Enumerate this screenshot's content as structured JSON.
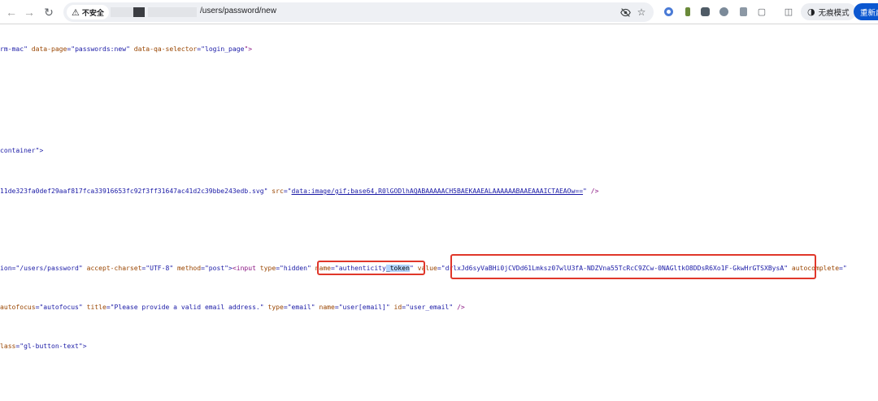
{
  "browser": {
    "security_label": "不安全",
    "url": "/users/password/new",
    "incognito_label": "无痕模式",
    "relaunch_label": "重新启"
  },
  "source": {
    "line1": [
      {
        "t": "rm-mac\" ",
        "c": "val"
      },
      {
        "t": "data-page",
        "c": "attr"
      },
      {
        "t": "=\"",
        "c": "val"
      },
      {
        "t": "passwords:new",
        "c": "val"
      },
      {
        "t": "\" ",
        "c": "val"
      },
      {
        "t": "data-qa-selector",
        "c": "attr"
      },
      {
        "t": "=\"",
        "c": "val"
      },
      {
        "t": "login_page",
        "c": "val"
      },
      {
        "t": "\">",
        "c": "tag"
      }
    ],
    "line2": [
      {
        "t": "container\">",
        "c": "val"
      }
    ],
    "line3": [
      {
        "t": "11de323fa0def29aaf817fca33916653fc92f3ff31647ac41d2c39bbe243edb.svg\" ",
        "c": "val"
      },
      {
        "t": "src",
        "c": "attr"
      },
      {
        "t": "=\"",
        "c": "val"
      },
      {
        "t": "data:image/gif;base64,R0lGODlhAQABAAAAACH5BAEKAAEALAAAAAABAAEAAAICTAEAOw==",
        "c": "link"
      },
      {
        "t": "\" ",
        "c": "val"
      },
      {
        "t": "/>",
        "c": "tag"
      }
    ],
    "line4": [
      {
        "t": "ion=\"/users/password\" ",
        "c": "val"
      },
      {
        "t": "accept-charset",
        "c": "attr"
      },
      {
        "t": "=\"UTF-8\" ",
        "c": "val"
      },
      {
        "t": "method",
        "c": "attr"
      },
      {
        "t": "=\"post\">",
        "c": "val"
      },
      {
        "t": "<input ",
        "c": "tag"
      },
      {
        "t": "type",
        "c": "attr"
      },
      {
        "t": "=\"hidden\" ",
        "c": "val"
      },
      {
        "t": "name",
        "c": "attr"
      },
      {
        "t": "=\"authenticity",
        "c": "val"
      },
      {
        "t": "_token",
        "c": "sel"
      },
      {
        "t": "\" ",
        "c": "val"
      },
      {
        "t": "value",
        "c": "attr"
      },
      {
        "t": "=\"drlxJd6syVaBHi0jCVDd61Lmksz07wlU3fA-NDZVna55TcRcC9ZCw-0NAGltkO8DDsR6Xo1F-GkwHrGTSXBysA\" ",
        "c": "val"
      },
      {
        "t": "autocomplete",
        "c": "attr"
      },
      {
        "t": "=\"",
        "c": "val"
      }
    ],
    "line5": [
      {
        "t": "autofocus",
        "c": "attr"
      },
      {
        "t": "=\"autofocus\" ",
        "c": "val"
      },
      {
        "t": "title",
        "c": "attr"
      },
      {
        "t": "=\"Please provide a valid email address.\" ",
        "c": "val"
      },
      {
        "t": "type",
        "c": "attr"
      },
      {
        "t": "=\"email\" ",
        "c": "val"
      },
      {
        "t": "name",
        "c": "attr"
      },
      {
        "t": "=\"user[email]\" ",
        "c": "val"
      },
      {
        "t": "id",
        "c": "attr"
      },
      {
        "t": "=\"user_email\" ",
        "c": "val"
      },
      {
        "t": "/>",
        "c": "tag"
      }
    ],
    "line6": [
      {
        "t": "lass",
        "c": "attr"
      },
      {
        "t": "=\"gl-button-text\">",
        "c": "val"
      }
    ]
  },
  "colors": {
    "highlight_box": "#e0372a",
    "attribute": "#994500",
    "value": "#1a1aa6",
    "tag": "#881280",
    "relaunch": "#0b57d0"
  },
  "icons": [
    "back-icon",
    "forward-icon",
    "reload-icon",
    "warning-icon",
    "eye-off-icon",
    "star-icon",
    "extension-icon",
    "sidebar-icon",
    "incognito-icon"
  ]
}
